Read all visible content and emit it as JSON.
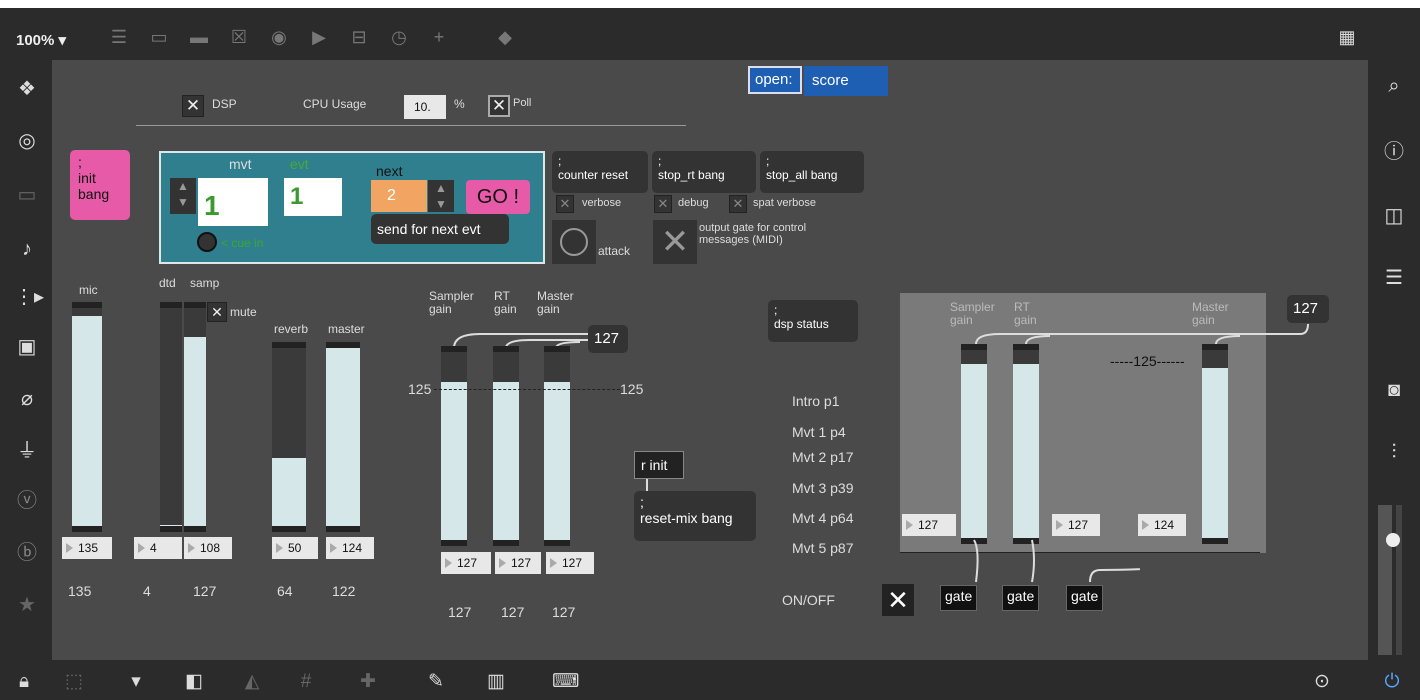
{
  "toolbar": {
    "zoom": "100% ▾"
  },
  "header": {
    "dsp_label": "DSP",
    "cpu_label": "CPU Usage",
    "cpu_value": "10.",
    "cpu_unit": "%",
    "poll_label": "Poll",
    "open_label": "open:",
    "open_value": "score"
  },
  "init": {
    "semicolon": ";",
    "line1": "init",
    "line2": "bang"
  },
  "cue": {
    "mvt_label": "mvt",
    "evt_label": "evt",
    "next_label": "next",
    "mvt_value": "1",
    "evt_value": "1",
    "next_value": "2",
    "go_label": "GO !",
    "cue_in": "< cue in",
    "send_label": "send for next evt"
  },
  "messages": {
    "counter_reset": "counter reset",
    "stop_rt": "stop_rt bang",
    "stop_all": "stop_all bang",
    "semicolon": ";",
    "verbose": "verbose",
    "debug": "debug",
    "spat_verbose": "spat verbose",
    "attack": "attack",
    "output_gate": "output gate for control messages (MIDI)",
    "dsp_status": "dsp status",
    "r_init": "r init",
    "reset_mix": "reset-mix bang"
  },
  "mixer": {
    "mic": "mic",
    "dtd": "dtd",
    "samp": "samp",
    "mute": "mute",
    "reverb": "reverb",
    "master": "master",
    "num_mic": "135",
    "num_dtd": "4",
    "num_samp": "108",
    "num_reverb": "50",
    "num_master": "124",
    "val_mic": "135",
    "val_dtd": "4",
    "val_samp": "127",
    "val_reverb": "64",
    "val_master": "122",
    "levels": {
      "mic": 0.94,
      "dtd": 0.03,
      "samp": 0.85,
      "reverb": 0.39,
      "master": 0.97
    }
  },
  "gains": {
    "sampler": "Sampler gain",
    "rt": "RT gain",
    "master": "Master gain",
    "top_num": "127",
    "mark_left": "125",
    "mark_right": "125",
    "num1": "127",
    "num2": "127",
    "num3": "127",
    "val1": "127",
    "val2": "127",
    "val3": "127"
  },
  "sections": {
    "intro": "Intro  p1",
    "mvt1": "Mvt 1 p4",
    "mvt2": "Mvt 2 p17",
    "mvt3": "Mvt 3 p39",
    "mvt4": "Mvt 4 p64",
    "mvt5": "Mvt 5 p87"
  },
  "panel": {
    "sampler": "Sampler gain",
    "rt": "RT gain",
    "master": "Master gain",
    "top_num": "127",
    "mark": "-----125------",
    "num_a": "127",
    "num_b": "127",
    "num_c": "124"
  },
  "onoff": {
    "label": "ON/OFF",
    "gate1": "gate",
    "gate2": "gate",
    "gate3": "gate"
  }
}
